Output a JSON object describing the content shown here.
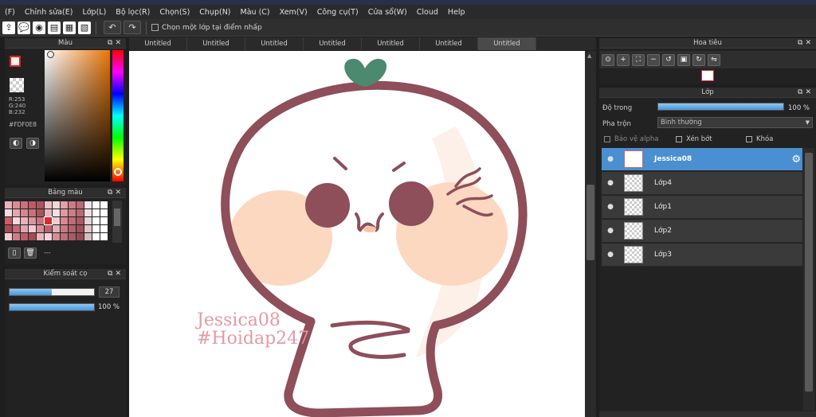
{
  "menu": [
    "(F)",
    "Chỉnh sửa(E)",
    "Lớp(L)",
    "Bộ lọc(R)",
    "Chọn(S)",
    "Chụp(N)",
    "Màu (C)",
    "Xem(V)",
    "Công cụ(T)",
    "Cửa sổ(W)",
    "Cloud",
    "Help"
  ],
  "toolbar": {
    "select_one_layer_label": "Chọn một lớp tại điểm nhấp"
  },
  "color_panel": {
    "title": "Màu",
    "r": "R:253",
    "g": "G:240",
    "b": "B:232",
    "hex": "#FDF0E8",
    "current_color": "#FDF0E8"
  },
  "palette_panel": {
    "title": "Bảng màu",
    "dash_label": "---",
    "swatches": [
      "#e8b4b8",
      "#d98c93",
      "#c9707a",
      "#b85c66",
      "#a85560",
      "#e9c0c4",
      "#f2d6d9",
      "#e0a1a8",
      "#cc7b84",
      "#b96a73",
      "#f0e4e6",
      "#ffffff",
      "#ffffff",
      "#f3dcdf",
      "#e3a7ae",
      "#d38891",
      "#c4737d",
      "#a85560",
      "#e6b8bd",
      "#f5dfe2",
      "#dd9aa2",
      "#c97f88",
      "#b56a74",
      "#efe1e3",
      "#ffffff",
      "#ffffff",
      "#c65f6a",
      "#f5d9dc",
      "#e7b3b8",
      "#d896a0",
      "#c27780",
      "#d32f2f",
      "#f0ccd0",
      "#d98890",
      "#c06c76",
      "#aa5a64",
      "#e9d4d7",
      "#ffffff",
      "#ffffff",
      "#a24b56",
      "#bf6a74",
      "#e0a6ad",
      "#f1c9ce",
      "#d68f98",
      "#b86571",
      "#e1b0b6",
      "#c57b84",
      "#b0636d",
      "#9d525c",
      "#dfc7ca",
      "#ffffff",
      "#ffffff",
      "#f0d2d6",
      "#cd7c86",
      "#b7606a",
      "#a24b56",
      "#e7b7bd",
      "#f3d6da",
      "#d38d96",
      "#bd6f79",
      "#a75b65",
      "#934c56",
      "#d8bcc0",
      "#ffffff",
      "#ffffff"
    ]
  },
  "brush_panel": {
    "title": "Kiểm soát cọ",
    "size_value": "27",
    "size_fraction": 0.5,
    "opacity_value": "100 %",
    "opacity_fraction": 1.0
  },
  "tabs": [
    "Untitled",
    "Untitled",
    "Untitled",
    "Untitled",
    "Untitled",
    "Untitled",
    "Untitled"
  ],
  "canvas": {
    "watermark_line1": "Jessica08",
    "watermark_line2": "#Hoidap247"
  },
  "navigator_panel": {
    "title": "Hoa tiêu"
  },
  "layer_panel": {
    "title": "Lớp",
    "opacity_label": "Độ trong",
    "opacity_value": "100 %",
    "opacity_fraction": 1.0,
    "blend_label": "Pha trộn",
    "blend_value": "Bình thường",
    "protect_alpha": "Bảo vệ alpha",
    "clipping": "Xén bớt",
    "lock": "Khóa",
    "layers": [
      "Jessica08",
      "Lớp4",
      "Lớp1",
      "Lớp2",
      "Lớp3"
    ]
  }
}
